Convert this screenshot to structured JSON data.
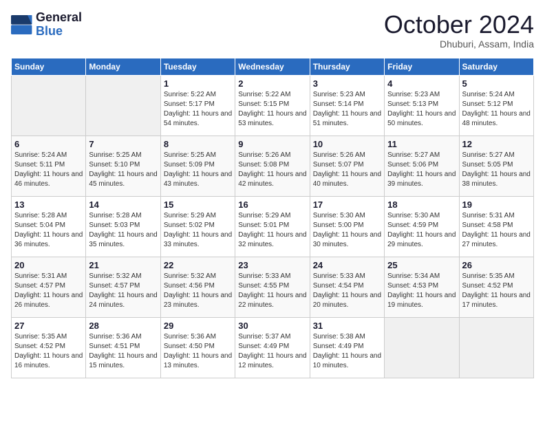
{
  "logo": {
    "line1": "General",
    "line2": "Blue"
  },
  "title": "October 2024",
  "subtitle": "Dhuburi, Assam, India",
  "days_of_week": [
    "Sunday",
    "Monday",
    "Tuesday",
    "Wednesday",
    "Thursday",
    "Friday",
    "Saturday"
  ],
  "weeks": [
    [
      {
        "day": "",
        "info": ""
      },
      {
        "day": "",
        "info": ""
      },
      {
        "day": "1",
        "info": "Sunrise: 5:22 AM\nSunset: 5:17 PM\nDaylight: 11 hours and 54 minutes."
      },
      {
        "day": "2",
        "info": "Sunrise: 5:22 AM\nSunset: 5:15 PM\nDaylight: 11 hours and 53 minutes."
      },
      {
        "day": "3",
        "info": "Sunrise: 5:23 AM\nSunset: 5:14 PM\nDaylight: 11 hours and 51 minutes."
      },
      {
        "day": "4",
        "info": "Sunrise: 5:23 AM\nSunset: 5:13 PM\nDaylight: 11 hours and 50 minutes."
      },
      {
        "day": "5",
        "info": "Sunrise: 5:24 AM\nSunset: 5:12 PM\nDaylight: 11 hours and 48 minutes."
      }
    ],
    [
      {
        "day": "6",
        "info": "Sunrise: 5:24 AM\nSunset: 5:11 PM\nDaylight: 11 hours and 46 minutes."
      },
      {
        "day": "7",
        "info": "Sunrise: 5:25 AM\nSunset: 5:10 PM\nDaylight: 11 hours and 45 minutes."
      },
      {
        "day": "8",
        "info": "Sunrise: 5:25 AM\nSunset: 5:09 PM\nDaylight: 11 hours and 43 minutes."
      },
      {
        "day": "9",
        "info": "Sunrise: 5:26 AM\nSunset: 5:08 PM\nDaylight: 11 hours and 42 minutes."
      },
      {
        "day": "10",
        "info": "Sunrise: 5:26 AM\nSunset: 5:07 PM\nDaylight: 11 hours and 40 minutes."
      },
      {
        "day": "11",
        "info": "Sunrise: 5:27 AM\nSunset: 5:06 PM\nDaylight: 11 hours and 39 minutes."
      },
      {
        "day": "12",
        "info": "Sunrise: 5:27 AM\nSunset: 5:05 PM\nDaylight: 11 hours and 38 minutes."
      }
    ],
    [
      {
        "day": "13",
        "info": "Sunrise: 5:28 AM\nSunset: 5:04 PM\nDaylight: 11 hours and 36 minutes."
      },
      {
        "day": "14",
        "info": "Sunrise: 5:28 AM\nSunset: 5:03 PM\nDaylight: 11 hours and 35 minutes."
      },
      {
        "day": "15",
        "info": "Sunrise: 5:29 AM\nSunset: 5:02 PM\nDaylight: 11 hours and 33 minutes."
      },
      {
        "day": "16",
        "info": "Sunrise: 5:29 AM\nSunset: 5:01 PM\nDaylight: 11 hours and 32 minutes."
      },
      {
        "day": "17",
        "info": "Sunrise: 5:30 AM\nSunset: 5:00 PM\nDaylight: 11 hours and 30 minutes."
      },
      {
        "day": "18",
        "info": "Sunrise: 5:30 AM\nSunset: 4:59 PM\nDaylight: 11 hours and 29 minutes."
      },
      {
        "day": "19",
        "info": "Sunrise: 5:31 AM\nSunset: 4:58 PM\nDaylight: 11 hours and 27 minutes."
      }
    ],
    [
      {
        "day": "20",
        "info": "Sunrise: 5:31 AM\nSunset: 4:57 PM\nDaylight: 11 hours and 26 minutes."
      },
      {
        "day": "21",
        "info": "Sunrise: 5:32 AM\nSunset: 4:57 PM\nDaylight: 11 hours and 24 minutes."
      },
      {
        "day": "22",
        "info": "Sunrise: 5:32 AM\nSunset: 4:56 PM\nDaylight: 11 hours and 23 minutes."
      },
      {
        "day": "23",
        "info": "Sunrise: 5:33 AM\nSunset: 4:55 PM\nDaylight: 11 hours and 22 minutes."
      },
      {
        "day": "24",
        "info": "Sunrise: 5:33 AM\nSunset: 4:54 PM\nDaylight: 11 hours and 20 minutes."
      },
      {
        "day": "25",
        "info": "Sunrise: 5:34 AM\nSunset: 4:53 PM\nDaylight: 11 hours and 19 minutes."
      },
      {
        "day": "26",
        "info": "Sunrise: 5:35 AM\nSunset: 4:52 PM\nDaylight: 11 hours and 17 minutes."
      }
    ],
    [
      {
        "day": "27",
        "info": "Sunrise: 5:35 AM\nSunset: 4:52 PM\nDaylight: 11 hours and 16 minutes."
      },
      {
        "day": "28",
        "info": "Sunrise: 5:36 AM\nSunset: 4:51 PM\nDaylight: 11 hours and 15 minutes."
      },
      {
        "day": "29",
        "info": "Sunrise: 5:36 AM\nSunset: 4:50 PM\nDaylight: 11 hours and 13 minutes."
      },
      {
        "day": "30",
        "info": "Sunrise: 5:37 AM\nSunset: 4:49 PM\nDaylight: 11 hours and 12 minutes."
      },
      {
        "day": "31",
        "info": "Sunrise: 5:38 AM\nSunset: 4:49 PM\nDaylight: 11 hours and 10 minutes."
      },
      {
        "day": "",
        "info": ""
      },
      {
        "day": "",
        "info": ""
      }
    ]
  ]
}
